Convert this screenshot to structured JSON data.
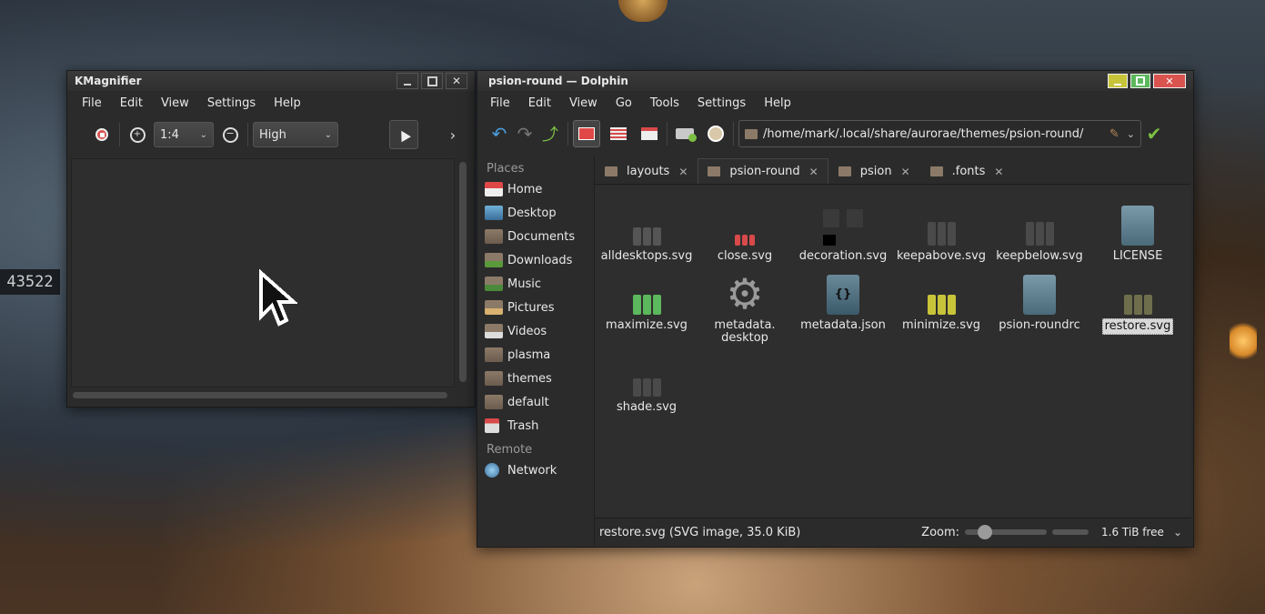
{
  "kmagnifier": {
    "title": "KMagnifier",
    "menu": [
      "File",
      "Edit",
      "View",
      "Settings",
      "Help"
    ],
    "zoom_value": "1:4",
    "quality_value": "High"
  },
  "dolphin": {
    "title": "psion-round — Dolphin",
    "menu": [
      "File",
      "Edit",
      "View",
      "Go",
      "Tools",
      "Settings",
      "Help"
    ],
    "path": "/home/mark/.local/share/aurorae/themes/psion-round/",
    "places_heading": "Places",
    "places": [
      "Home",
      "Desktop",
      "Documents",
      "Downloads",
      "Music",
      "Pictures",
      "Videos",
      "plasma",
      "themes",
      "default",
      "Trash"
    ],
    "remote_heading": "Remote",
    "remote": [
      "Network"
    ],
    "tabs": [
      "layouts",
      "psion-round",
      "psion",
      ".fonts"
    ],
    "files": [
      "alldesktops.svg",
      "close.svg",
      "decoration.svg",
      "keepabove.svg",
      "keepbelow.svg",
      "LICENSE",
      "maximize.svg",
      "metadata.desktop",
      "metadata.json",
      "minimize.svg",
      "psion-roundrc",
      "restore.svg",
      "shade.svg"
    ],
    "status_text": "restore.svg (SVG image, 35.0 KiB)",
    "zoom_label": "Zoom:",
    "free_space": "1.6 TiB free"
  },
  "colors": {
    "accent": "#7cc043",
    "close_red": "#d9534f",
    "max_green": "#5cb85c",
    "min_yellow": "#c8c43a"
  }
}
